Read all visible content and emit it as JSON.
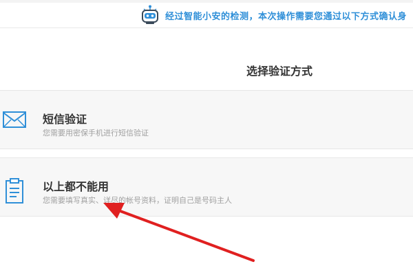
{
  "notice": {
    "text": "经过智能小安的检测，本次操作需要您通过以下方式确认身",
    "icon": "robot-icon"
  },
  "section": {
    "title": "选择验证方式"
  },
  "options": [
    {
      "title": "短信验证",
      "description": "您需要用密保手机进行短信验证",
      "icon": "envelope-icon"
    },
    {
      "title": "以上都不能用",
      "description": "您需要填写真实、详尽的帐号资料，证明自己是号码主人",
      "icon": "clipboard-icon"
    }
  ],
  "colors": {
    "accent": "#2f8fd8",
    "arrow": "#e02020"
  },
  "annotation": {
    "icon": "red-arrow-icon"
  }
}
